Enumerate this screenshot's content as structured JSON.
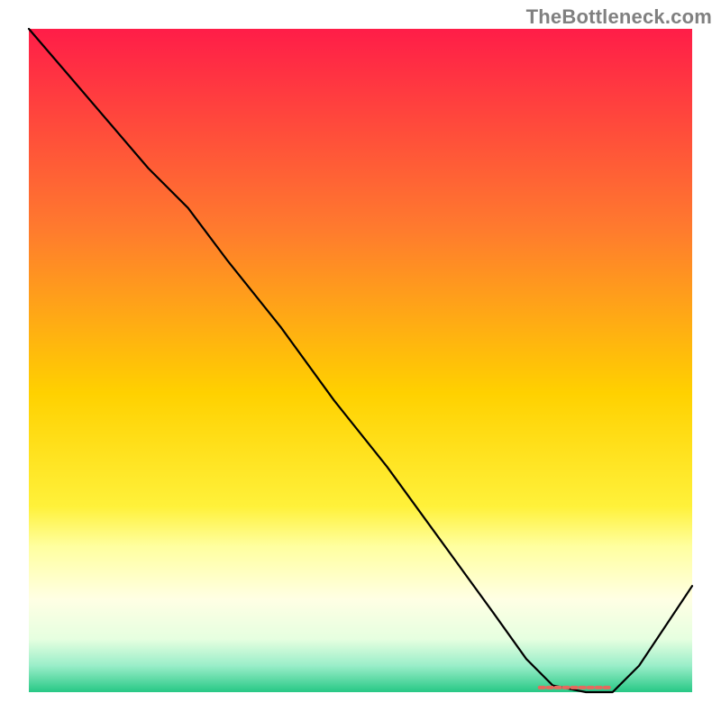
{
  "watermark": "TheBottleneck.com",
  "chart_data": {
    "type": "line",
    "title": "",
    "xlabel": "",
    "ylabel": "",
    "xlim": [
      0,
      100
    ],
    "ylim": [
      0,
      100
    ],
    "background_gradient": {
      "stops": [
        {
          "offset": 0.0,
          "color": "#ff1d48"
        },
        {
          "offset": 0.3,
          "color": "#ff7a2e"
        },
        {
          "offset": 0.55,
          "color": "#ffd100"
        },
        {
          "offset": 0.72,
          "color": "#fff13a"
        },
        {
          "offset": 0.78,
          "color": "#ffff9f"
        },
        {
          "offset": 0.86,
          "color": "#ffffe4"
        },
        {
          "offset": 0.92,
          "color": "#e6ffe0"
        },
        {
          "offset": 0.96,
          "color": "#9aeec9"
        },
        {
          "offset": 1.0,
          "color": "#27c885"
        }
      ]
    },
    "series": [
      {
        "name": "bottleneck-curve",
        "x": [
          0,
          6,
          12,
          18,
          24,
          30,
          38,
          46,
          54,
          62,
          70,
          75,
          79,
          84,
          88,
          92,
          96,
          100
        ],
        "y": [
          100,
          93,
          86,
          79,
          73,
          65,
          55,
          44,
          34,
          23,
          12,
          5,
          1,
          0,
          0,
          4,
          10,
          16
        ],
        "color": "#000000"
      }
    ],
    "annotations": [
      {
        "name": "optimal-range-marker",
        "kind": "dashed-segment",
        "x_start": 77,
        "x_end": 88,
        "y": 0.7,
        "color": "#e46a5e",
        "dash": [
          5,
          4
        ],
        "width": 4
      }
    ]
  }
}
